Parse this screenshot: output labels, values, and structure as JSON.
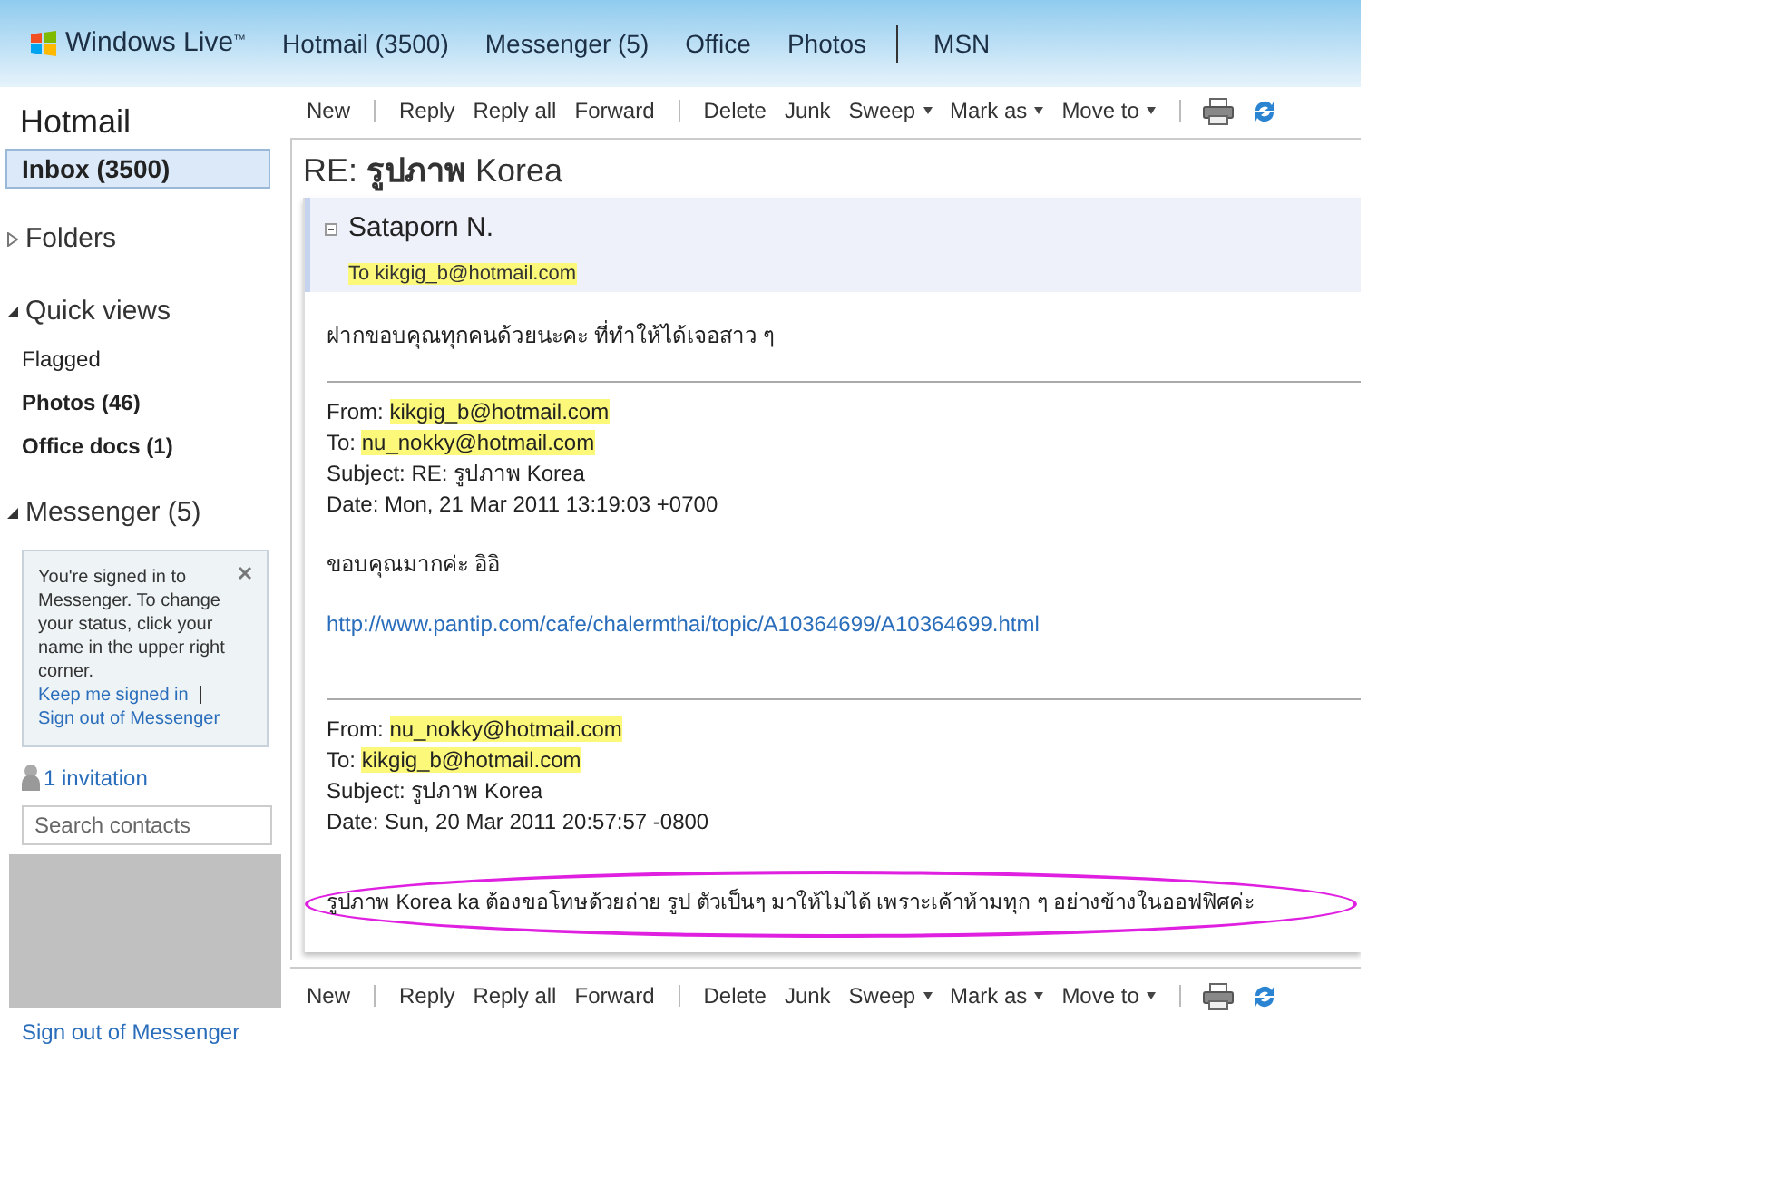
{
  "header": {
    "brand": "Windows Live$^{™}$",
    "nav": [
      {
        "label": "Hotmail (3500)",
        "divider_before": false
      },
      {
        "label": "Messenger (5)",
        "divider_before": false
      },
      {
        "label": "Office",
        "divider_before": false
      },
      {
        "label": "Photos",
        "divider_before": false
      },
      {
        "label": "MSN",
        "divider_before": true
      }
    ]
  },
  "sidebar": {
    "title": "Hotmail",
    "inbox": {
      "label": "Inbox (3500)",
      "selected": true
    },
    "folders": {
      "label": "Folders",
      "expanded": false
    },
    "quick_views": {
      "label": "Quick views",
      "expanded": true,
      "items": [
        {
          "label": "Flagged",
          "unread": false
        },
        {
          "label": "Photos (46)",
          "unread": true
        },
        {
          "label": "Office docs (1)",
          "unread": true
        }
      ]
    },
    "messenger": {
      "label": "Messenger (5)",
      "expanded": true,
      "notice": {
        "text": "You're signed in to Messenger. To change your status, click your name in the upper right corner.",
        "links": [
          "Keep me signed in",
          "Sign out of Messenger"
        ]
      },
      "invitation": "1 invitation",
      "search_placeholder": "Search contacts",
      "sign_out": "Sign out of Messenger"
    }
  },
  "toolbar_top": [
    {
      "kind": "button",
      "label": "New"
    },
    {
      "kind": "separator"
    },
    {
      "kind": "button",
      "label": "Reply"
    },
    {
      "kind": "button",
      "label": "Reply all"
    },
    {
      "kind": "button",
      "label": "Forward"
    },
    {
      "kind": "separator"
    },
    {
      "kind": "button",
      "label": "Delete"
    },
    {
      "kind": "button",
      "label": "Junk"
    },
    {
      "kind": "menu",
      "label": "Sweep"
    },
    {
      "kind": "menu",
      "label": "Mark as"
    },
    {
      "kind": "menu",
      "label": "Move to"
    },
    {
      "kind": "separator"
    },
    {
      "kind": "print"
    },
    {
      "kind": "refresh"
    }
  ],
  "message": {
    "subject": "RE: **รูปภาพ** Korea",
    "sender": "Sataporn N.",
    "to": "To kikgig_b@hotmail.com",
    "body": [
      {
        "kind": "text",
        "text": "ฝากขอบคุณทุกคนด้วยนะคะ ที่ทำให้ได้เจอสาว ๆ"
      },
      {
        "kind": "rule"
      },
      {
        "kind": "header",
        "label": "From:",
        "value": "kikgig_b@hotmail.com",
        "redacted": true
      },
      {
        "kind": "header",
        "label": "To:",
        "value": "nu_nokky@hotmail.com",
        "redacted": true
      },
      {
        "kind": "header",
        "label": "Subject:",
        "value": "RE: รูปภาพ Korea",
        "redacted": false
      },
      {
        "kind": "header",
        "label": "Date:",
        "value": "Mon, 21 Mar 2011 13:19:03 +0700",
        "redacted": false
      },
      {
        "kind": "text",
        "text": "ขอบคุณมากค่ะ อิอิ"
      },
      {
        "kind": "link",
        "text": "http://www.pantip.com/cafe/chalermthai/topic/A10364699/A10364699.html"
      },
      {
        "kind": "rule"
      },
      {
        "kind": "header",
        "label": "From:",
        "value": "nu_nokky@hotmail.com",
        "redacted": true
      },
      {
        "kind": "header",
        "label": "To:",
        "value": "kikgig_b@hotmail.com",
        "redacted": true
      },
      {
        "kind": "header",
        "label": "Subject:",
        "value": "รูปภาพ Korea",
        "redacted": false
      },
      {
        "kind": "header",
        "label": "Date:",
        "value": "Sun, 20 Mar 2011 20:57:57 -0800",
        "redacted": false
      },
      {
        "kind": "circled",
        "text": "รูปภาพ Korea ka ต้องขอโทษด้วยถ่าย รูป ตัวเป็นๆ มาให้ไม่ได้ เพราะเค้าห้ามทุก ๆ อย่างข้างในออฟฟิศค่ะ"
      }
    ]
  },
  "toolbar_bottom": [
    {
      "kind": "button",
      "label": "New"
    },
    {
      "kind": "separator"
    },
    {
      "kind": "button",
      "label": "Reply"
    },
    {
      "kind": "button",
      "label": "Reply all"
    },
    {
      "kind": "button",
      "label": "Forward"
    },
    {
      "kind": "separator"
    },
    {
      "kind": "button",
      "label": "Delete"
    },
    {
      "kind": "button",
      "label": "Junk"
    },
    {
      "kind": "menu",
      "label": "Sweep"
    },
    {
      "kind": "menu",
      "label": "Mark as"
    },
    {
      "kind": "menu",
      "label": "Move to"
    },
    {
      "kind": "separator"
    },
    {
      "kind": "print"
    },
    {
      "kind": "refresh"
    }
  ]
}
